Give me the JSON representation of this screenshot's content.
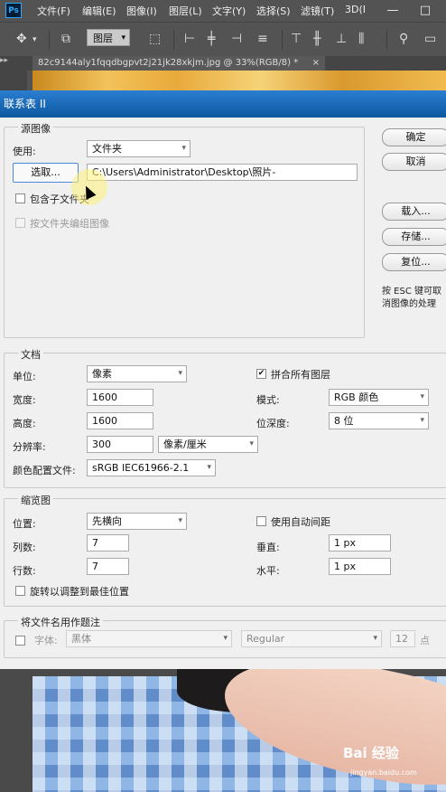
{
  "app": {
    "logo": "Ps",
    "menu": [
      "文件(F)",
      "编辑(E)",
      "图像(I)",
      "图层(L)",
      "文字(Y)",
      "选择(S)",
      "滤镜(T)",
      "3D(I"
    ],
    "window_buttons": {
      "minimize": "—",
      "restore": "□"
    },
    "options_bar": {
      "layer_select": "图层",
      "layer_select_options": [
        "图层"
      ]
    },
    "doc_tab": "82c9144aly1fqqdbgpvt2j21jk28xkjm.jpg @ 33%(RGB/8) *",
    "doc_tab_close": "×",
    "left_strip": "▸▸"
  },
  "dialog": {
    "title": "联系表 II",
    "source": {
      "group": "源图像",
      "use_label": "使用:",
      "use_value": "文件夹",
      "choose_button": "选取...",
      "path": "C:\\Users\\Administrator\\Desktop\\照片-",
      "include_subfolders": "包含子文件夹",
      "group_by_folder": "按文件夹编组图像"
    },
    "buttons": {
      "ok": "确定",
      "cancel": "取消",
      "load": "载入...",
      "save": "存储...",
      "reset": "复位..."
    },
    "hint": "按 ESC 键可取消图像的处理",
    "document": {
      "group": "文档",
      "unit_label": "单位:",
      "unit_value": "像素",
      "width_label": "宽度:",
      "width_value": "1600",
      "height_label": "高度:",
      "height_value": "1600",
      "resolution_label": "分辨率:",
      "resolution_value": "300",
      "resolution_unit": "像素/厘米",
      "profile_label": "颜色配置文件:",
      "profile_value": "sRGB IEC61966-2.1",
      "flatten_label": "拼合所有图层",
      "flatten_checked": true,
      "mode_label": "模式:",
      "mode_value": "RGB 颜色",
      "depth_label": "位深度:",
      "depth_value": "8 位"
    },
    "thumbnails": {
      "group": "缩览图",
      "place_label": "位置:",
      "place_value": "先横向",
      "columns_label": "列数:",
      "columns_value": "7",
      "rows_label": "行数:",
      "rows_value": "7",
      "rotate_label": "旋转以调整到最佳位置",
      "auto_spacing_label": "使用自动间距",
      "vertical_label": "垂直:",
      "vertical_value": "1 px",
      "horizontal_label": "水平:",
      "horizontal_value": "1 px"
    },
    "caption": {
      "group": "将文件名用作题注",
      "font_label": "字体:",
      "font_value": "黑体",
      "style_value": "Regular",
      "size_value": "12",
      "size_unit": "点"
    }
  },
  "watermark": {
    "text": "Bai 经验",
    "url": "jingyan.baidu.com"
  }
}
